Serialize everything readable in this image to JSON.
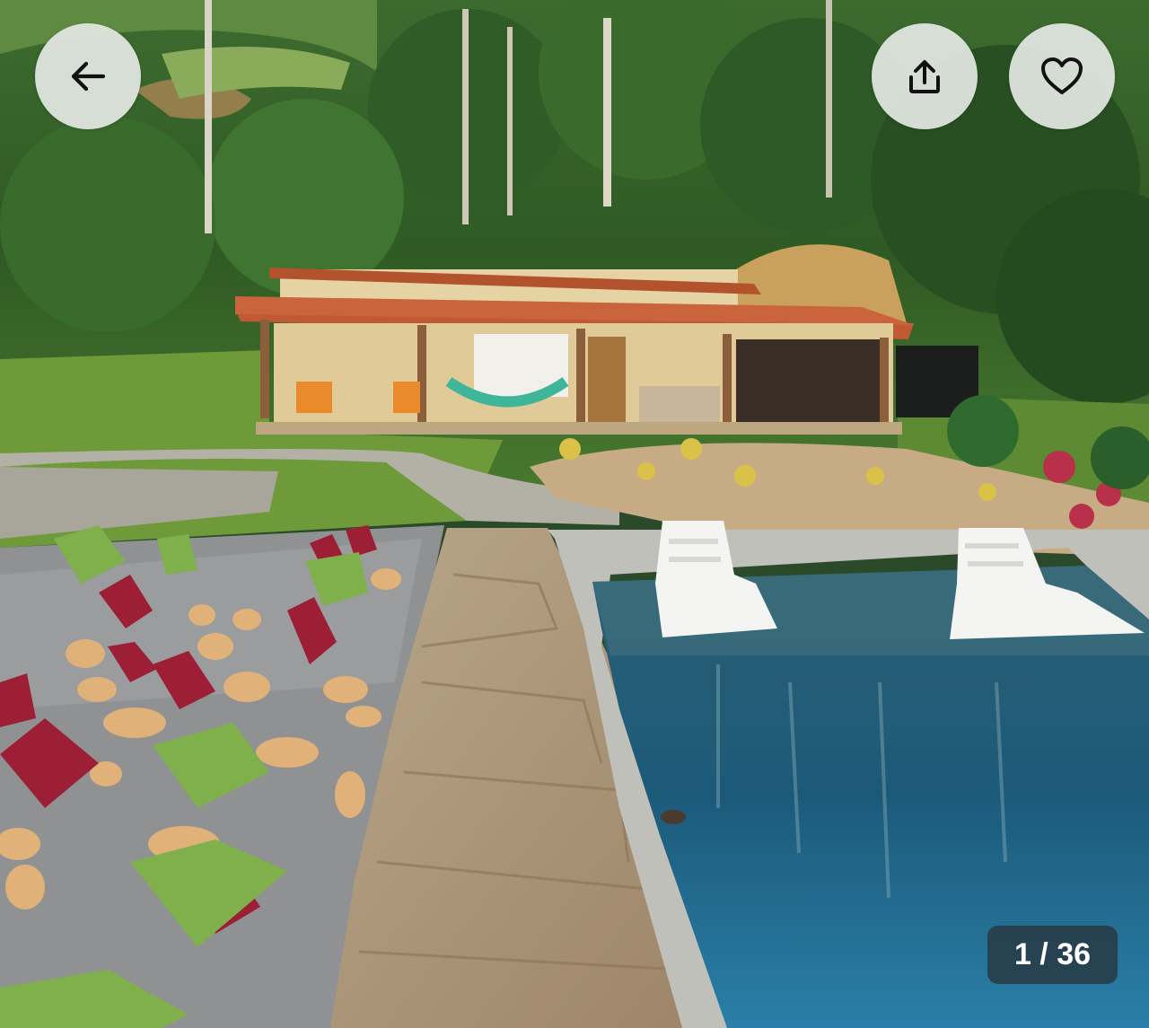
{
  "header": {
    "back_icon": "arrow-left-icon",
    "share_icon": "share-upload-icon",
    "favorite_icon": "heart-outline-icon"
  },
  "gallery": {
    "counter": "1 / 36",
    "current_index": 1,
    "total_photos": 36
  },
  "colors": {
    "button_bg": "#e4e8e4",
    "counter_bg": "#28343c",
    "counter_text": "#ffffff"
  }
}
